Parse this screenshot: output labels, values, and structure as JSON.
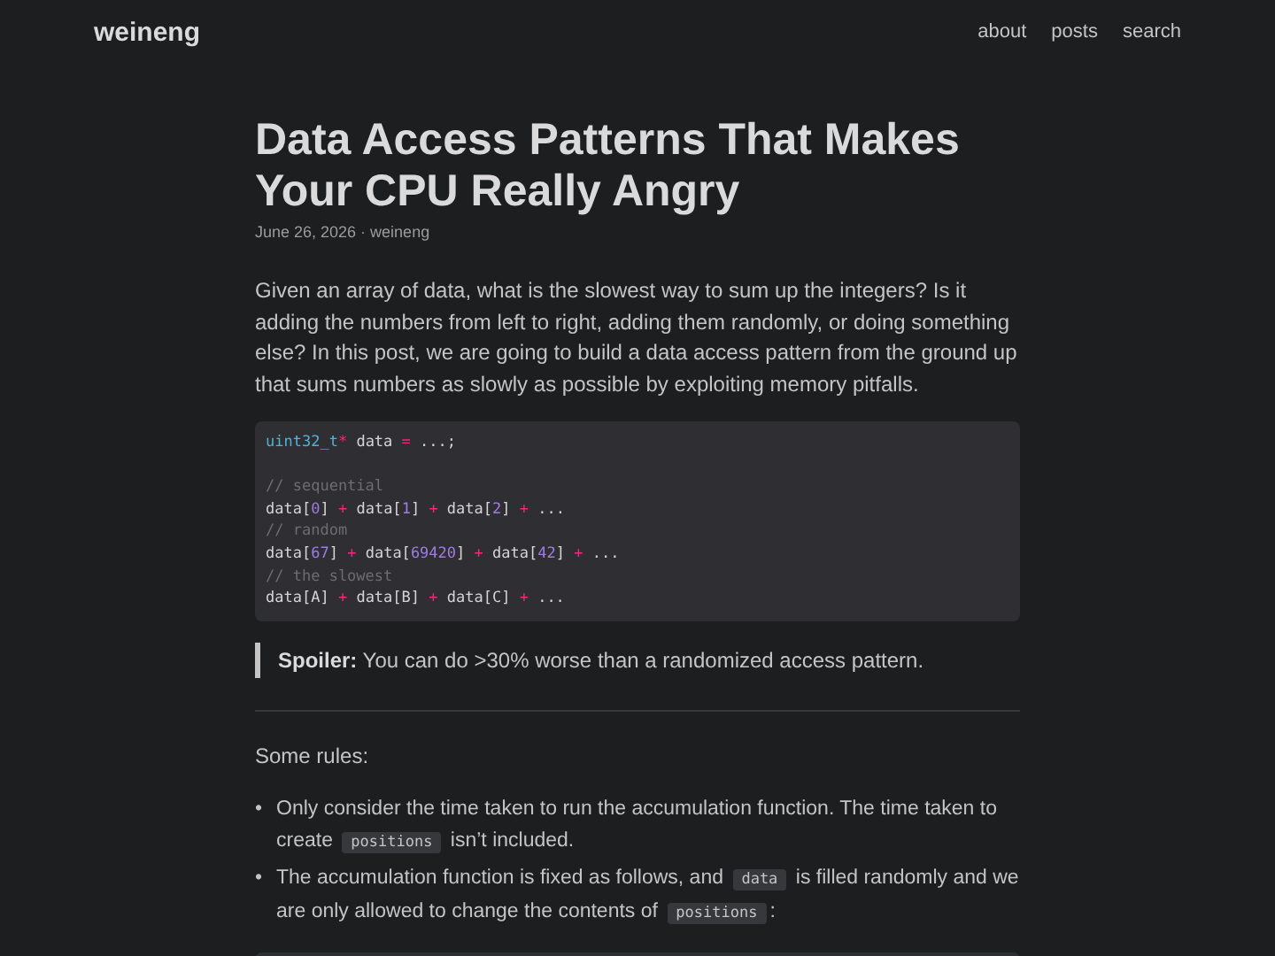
{
  "site": {
    "logo": "weineng",
    "nav": [
      "about",
      "posts",
      "search"
    ]
  },
  "post": {
    "title": "Data Access Patterns That Makes Your CPU Really Angry",
    "meta": "June 26, 2026 · weineng",
    "intro": "Given an array of data, what is the slowest way to sum up the integers? Is it adding the numbers from left to right, adding them randomly, or doing something else? In this post, we are going to build a data access pattern from the ground up that sums numbers as slowly as possible by exploiting memory pitfalls.",
    "code": [
      [
        {
          "kind": "type",
          "text": "uint32_t"
        },
        {
          "kind": "op",
          "text": "*"
        },
        {
          "kind": "plain",
          "text": " data "
        },
        {
          "kind": "op",
          "text": "="
        },
        {
          "kind": "plain",
          "text": " ...;"
        }
      ],
      [
        {
          "kind": "blank"
        }
      ],
      [
        {
          "kind": "comment",
          "text": "// sequential"
        }
      ],
      [
        {
          "kind": "plain",
          "text": "data["
        },
        {
          "kind": "num",
          "text": "0"
        },
        {
          "kind": "plain",
          "text": "] "
        },
        {
          "kind": "op",
          "text": "+"
        },
        {
          "kind": "plain",
          "text": " data["
        },
        {
          "kind": "num",
          "text": "1"
        },
        {
          "kind": "plain",
          "text": "] "
        },
        {
          "kind": "op",
          "text": "+"
        },
        {
          "kind": "plain",
          "text": " data["
        },
        {
          "kind": "num",
          "text": "2"
        },
        {
          "kind": "plain",
          "text": "] "
        },
        {
          "kind": "op",
          "text": "+"
        },
        {
          "kind": "plain",
          "text": " ..."
        }
      ],
      [
        {
          "kind": "comment",
          "text": "// random"
        }
      ],
      [
        {
          "kind": "plain",
          "text": "data["
        },
        {
          "kind": "num",
          "text": "67"
        },
        {
          "kind": "plain",
          "text": "] "
        },
        {
          "kind": "op",
          "text": "+"
        },
        {
          "kind": "plain",
          "text": " data["
        },
        {
          "kind": "num",
          "text": "69420"
        },
        {
          "kind": "plain",
          "text": "] "
        },
        {
          "kind": "op",
          "text": "+"
        },
        {
          "kind": "plain",
          "text": " data["
        },
        {
          "kind": "num",
          "text": "42"
        },
        {
          "kind": "plain",
          "text": "] "
        },
        {
          "kind": "op",
          "text": "+"
        },
        {
          "kind": "plain",
          "text": " ..."
        }
      ],
      [
        {
          "kind": "comment",
          "text": "// the slowest"
        }
      ],
      [
        {
          "kind": "plain",
          "text": "data[A] "
        },
        {
          "kind": "op",
          "text": "+"
        },
        {
          "kind": "plain",
          "text": " data[B] "
        },
        {
          "kind": "op",
          "text": "+"
        },
        {
          "kind": "plain",
          "text": " data[C] "
        },
        {
          "kind": "op",
          "text": "+"
        },
        {
          "kind": "plain",
          "text": " ..."
        }
      ]
    ],
    "quote": "**Spoiler:** You can do >30% worse than a randomized access pattern.",
    "rules_heading": "Some rules:",
    "rules": [
      {
        "marker": "•",
        "parts": [
          {
            "kind": "text",
            "text": "Only consider the time taken to run the accumulation function. The time taken to create "
          },
          {
            "kind": "code",
            "text": "positions"
          },
          {
            "kind": "text",
            "text": " isn’t included."
          }
        ]
      },
      {
        "marker": "•",
        "parts": [
          {
            "kind": "text",
            "text": "The accumulation function is fixed as follows, and "
          },
          {
            "kind": "code",
            "text": "data"
          },
          {
            "kind": "text",
            "text": " is filled randomly and we are only allowed to change the contents of "
          },
          {
            "kind": "code",
            "text": "positions"
          },
          {
            "kind": "text",
            "text": ":"
          }
        ]
      }
    ]
  }
}
